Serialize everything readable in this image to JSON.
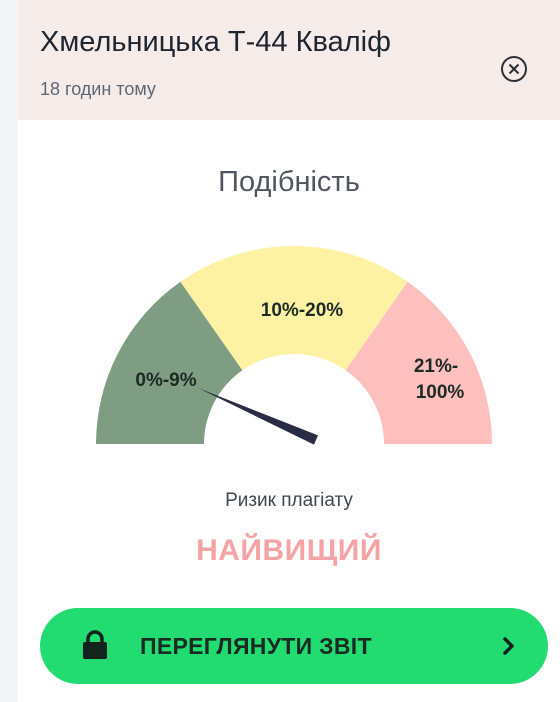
{
  "card": {
    "title": "Хмельницька Т-44 Кваліф",
    "time_ago": "18 годин тому",
    "close_icon": "close-circle-icon"
  },
  "similarity": {
    "title": "Подібність",
    "segments": [
      {
        "label": "0%-9%",
        "color": "#7f9d82"
      },
      {
        "label": "10%-20%",
        "color": "#fdf1a4"
      },
      {
        "label_line1": "21%-",
        "label_line2": "100%",
        "color": "#fec0bf"
      }
    ],
    "needle_value_percent": 7,
    "needle_color": "#2a2c44"
  },
  "risk": {
    "label": "Ризик плагіату",
    "value": "НАЙВИЩИЙ",
    "value_color": "#f6a3a6"
  },
  "view_report": {
    "label": "ПЕРЕГЛЯНУТИ ЗВІТ",
    "lock_icon": "lock-icon",
    "chevron_icon": "chevron-right-icon",
    "color": "#22dc71"
  }
}
